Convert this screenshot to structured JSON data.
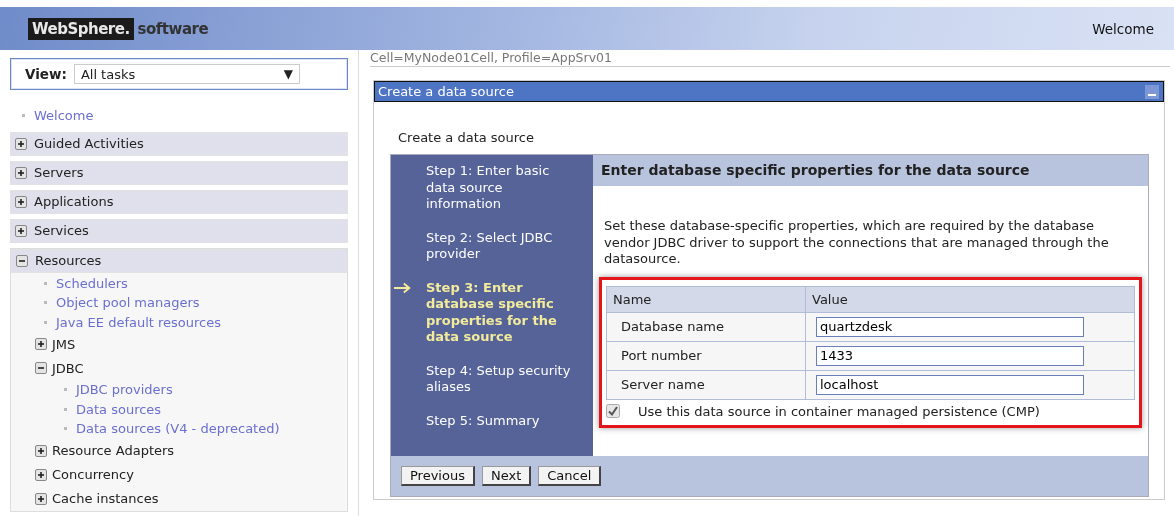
{
  "header": {
    "brand": "WebSphere.",
    "product": "software",
    "welcome": "Welcome"
  },
  "sidebar": {
    "view_label": "View:",
    "view_value": "All tasks",
    "view_caret": "▼",
    "nav": [
      {
        "kind": "link",
        "label": "Welcome"
      },
      {
        "kind": "section",
        "label": "Guided Activities",
        "expanded": false
      },
      {
        "kind": "section",
        "label": "Servers",
        "expanded": false
      },
      {
        "kind": "section",
        "label": "Applications",
        "expanded": false
      },
      {
        "kind": "section",
        "label": "Services",
        "expanded": false
      },
      {
        "kind": "section",
        "label": "Resources",
        "expanded": true,
        "children": [
          {
            "kind": "link",
            "label": "Schedulers"
          },
          {
            "kind": "link",
            "label": "Object pool managers"
          },
          {
            "kind": "link",
            "label": "Java EE default resources"
          },
          {
            "kind": "group",
            "label": "JMS",
            "expanded": false
          },
          {
            "kind": "group",
            "label": "JDBC",
            "expanded": true,
            "children": [
              {
                "kind": "link",
                "label": "JDBC providers"
              },
              {
                "kind": "link",
                "label": "Data sources"
              },
              {
                "kind": "link",
                "label": "Data sources (V4 - deprecated)"
              }
            ]
          },
          {
            "kind": "group",
            "label": "Resource Adapters",
            "expanded": false
          },
          {
            "kind": "group",
            "label": "Concurrency",
            "expanded": false
          },
          {
            "kind": "group",
            "label": "Cache instances",
            "expanded": false
          }
        ]
      }
    ]
  },
  "breadcrumb": "Cell=MyNode01Cell, Profile=AppSrv01",
  "panel": {
    "title": "Create a data source",
    "wizard_title": "Create a data source",
    "steps": [
      {
        "label": "Step 1: Enter basic data source information",
        "selected": false
      },
      {
        "label": "Step 2: Select JDBC provider",
        "selected": false
      },
      {
        "label": "Step 3: Enter database specific properties for the data source",
        "selected": true
      },
      {
        "label": "Step 4: Setup security aliases",
        "selected": false
      },
      {
        "label": "Step 5: Summary",
        "selected": false
      }
    ],
    "heading": "Enter database specific properties for the data source",
    "description": "Set these database-specific properties, which are required by the database vendor JDBC driver to support the connections that are managed through the datasource.",
    "table": {
      "columns": [
        "Name",
        "Value"
      ],
      "rows": [
        {
          "name": "Database name",
          "value": "quartzdesk"
        },
        {
          "name": "Port number",
          "value": "1433"
        },
        {
          "name": "Server name",
          "value": "localhost"
        }
      ]
    },
    "cmp": {
      "label": "Use this data source in container managed persistence (CMP)",
      "checked": true
    },
    "buttons": [
      "Previous",
      "Next",
      "Cancel"
    ]
  }
}
